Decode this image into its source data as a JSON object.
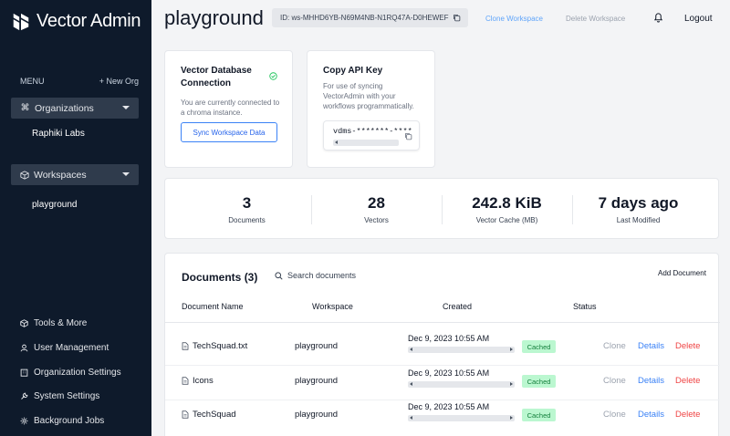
{
  "app": {
    "name": "Vector Admin"
  },
  "sidebar": {
    "menu_label": "MENU",
    "new_org_label": "+ New Org",
    "organizations_label": "Organizations",
    "organization_item": "Raphiki Labs",
    "workspaces_label": "Workspaces",
    "workspace_item": "playground",
    "bottom": {
      "tools": "Tools & More",
      "users": "User Management",
      "org_settings": "Organization Settings",
      "system_settings": "System Settings",
      "jobs": "Background Jobs"
    }
  },
  "header": {
    "title": "playground",
    "workspace_id": "ID: ws-MHHD6YB-N69M4NB-N1RQ47A-D0HEWEF",
    "clone_label": "Clone Workspace",
    "delete_label": "Delete Workspace",
    "logout_label": "Logout"
  },
  "connection_card": {
    "title": "Vector Database Connection",
    "description": "You are currently connected to a chroma instance.",
    "button_label": "Sync Workspace Data"
  },
  "api_card": {
    "title": "Copy API Key",
    "description": "For use of syncing VectorAdmin with your workflows programmatically.",
    "key_masked": "vdms-*******-****"
  },
  "stats": {
    "documents": {
      "value": "3",
      "label": "Documents"
    },
    "vectors": {
      "value": "28",
      "label": "Vectors"
    },
    "cache": {
      "value": "242.8 KiB",
      "label": "Vector Cache (MB)"
    },
    "modified": {
      "value": "7 days ago",
      "label": "Last Modified"
    }
  },
  "documents": {
    "title": "Documents",
    "count": "(3)",
    "search_placeholder": "Search documents",
    "add_label": "Add Document",
    "columns": {
      "name": "Document Name",
      "workspace": "Workspace",
      "created": "Created",
      "status": "Status"
    },
    "rows": [
      {
        "name": "TechSquad.txt",
        "workspace": "playground",
        "created": "Dec 9, 2023 10:55 AM",
        "status": "Cached"
      },
      {
        "name": "Icons",
        "workspace": "playground",
        "created": "Dec 9, 2023 10:55 AM",
        "status": "Cached"
      },
      {
        "name": "TechSquad",
        "workspace": "playground",
        "created": "Dec 9, 2023 10:55 AM",
        "status": "Cached"
      }
    ],
    "actions": {
      "clone": "Clone",
      "details": "Details",
      "delete": "Delete"
    }
  },
  "colors": {
    "sidebar_bg": "#0e1a2b",
    "accent": "#3b82f6",
    "danger": "#ef4444",
    "badge_bg": "#bbf7d0",
    "badge_text": "#15803d"
  },
  "icons": {
    "organizations": "command-icon",
    "workspaces": "box-icon",
    "tools": "cube-icon",
    "users": "user-icon",
    "org_settings": "building-icon",
    "system_settings": "wrench-icon",
    "jobs": "gear-icon"
  }
}
